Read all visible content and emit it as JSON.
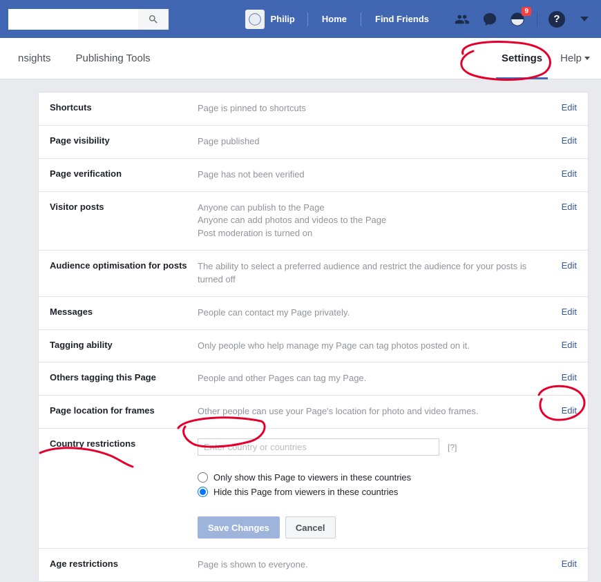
{
  "topbar": {
    "search_placeholder": "",
    "profile_name": "Philip",
    "links": {
      "home": "Home",
      "find_friends": "Find Friends"
    },
    "notification_badge": "9"
  },
  "tabs": {
    "insights": "nsights",
    "publishing": "Publishing Tools",
    "settings": "Settings",
    "help": "Help"
  },
  "rows": {
    "shortcuts": {
      "label": "Shortcuts",
      "value": "Page is pinned to shortcuts",
      "edit": "Edit"
    },
    "visibility": {
      "label": "Page visibility",
      "value": "Page published",
      "edit": "Edit"
    },
    "verification": {
      "label": "Page verification",
      "value": "Page has not been verified",
      "edit": "Edit"
    },
    "visitor_posts": {
      "label": "Visitor posts",
      "value_line1": "Anyone can publish to the Page",
      "value_line2": "Anyone can add photos and videos to the Page",
      "value_line3": "Post moderation is turned on",
      "edit": "Edit"
    },
    "audience_opt": {
      "label": "Audience optimisation for posts",
      "value": "The ability to select a preferred audience and restrict the audience for your posts is turned off",
      "edit": "Edit"
    },
    "messages": {
      "label": "Messages",
      "value": "People can contact my Page privately.",
      "edit": "Edit"
    },
    "tagging": {
      "label": "Tagging ability",
      "value": "Only people who help manage my Page can tag photos posted on it.",
      "edit": "Edit"
    },
    "others_tagging": {
      "label": "Others tagging this Page",
      "value": "People and other Pages can tag my Page.",
      "edit": "Edit"
    },
    "location_frames": {
      "label": "Page location for frames",
      "value": "Other people can use your Page's location for photo and video frames.",
      "edit": "Edit"
    },
    "country_restrictions": {
      "label": "Country restrictions",
      "input_placeholder": "Enter country or countries",
      "hint": "[?]",
      "option_show": "Only show this Page to viewers in these countries",
      "option_hide": "Hide this Page from viewers in these countries",
      "save": "Save Changes",
      "cancel": "Cancel"
    },
    "age": {
      "label": "Age restrictions",
      "value": "Page is shown to everyone.",
      "edit": "Edit"
    }
  }
}
